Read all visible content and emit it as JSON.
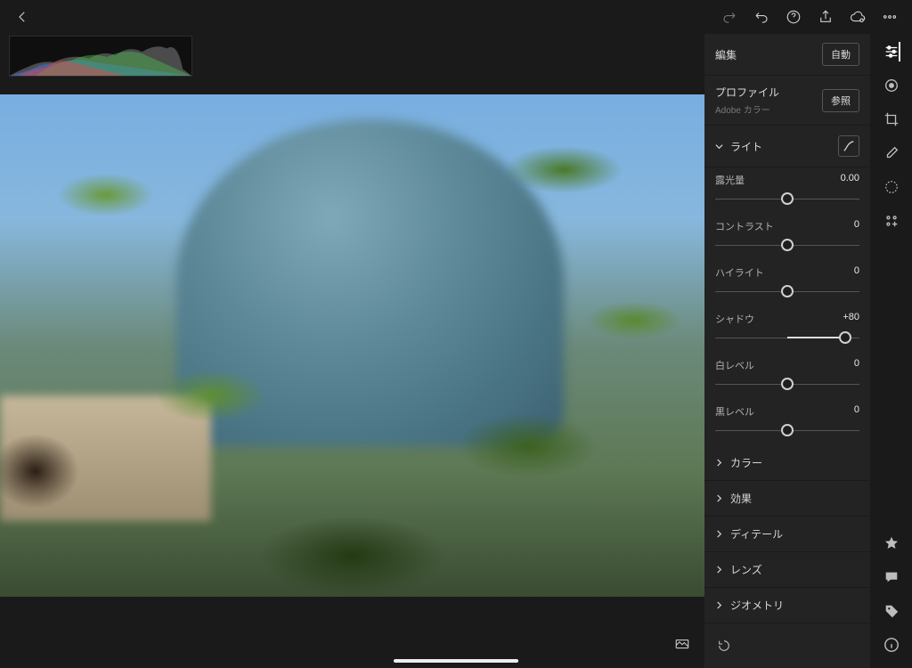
{
  "topbar": {
    "icons": {
      "back": "back-icon",
      "redo": "redo-icon",
      "undo": "undo-icon",
      "help": "help-icon",
      "share": "share-icon",
      "cloud": "cloud-icon",
      "more": "more-icon"
    }
  },
  "panel": {
    "edit_label": "編集",
    "auto_label": "自動",
    "profile_label": "プロファイル",
    "profile_name": "Adobe カラー",
    "browse_label": "参照",
    "reset_icon": "reset-icon"
  },
  "light": {
    "title": "ライト",
    "sliders": [
      {
        "label": "露光量",
        "value": "0.00",
        "pos": 50
      },
      {
        "label": "コントラスト",
        "value": "0",
        "pos": 50
      },
      {
        "label": "ハイライト",
        "value": "0",
        "pos": 50
      },
      {
        "label": "シャドウ",
        "value": "+80",
        "pos": 90
      },
      {
        "label": "白レベル",
        "value": "0",
        "pos": 50
      },
      {
        "label": "黒レベル",
        "value": "0",
        "pos": 50
      }
    ]
  },
  "sections": {
    "color": "カラー",
    "effects": "効果",
    "detail": "ディテール",
    "lens": "レンズ",
    "geometry": "ジオメトリ"
  },
  "tools": {
    "sliders": "adjust-icon",
    "color_mixer": "color-circle-icon",
    "crop": "crop-icon",
    "healing": "healing-brush-icon",
    "masking": "masking-icon",
    "presets": "presets-icon",
    "star": "star-icon",
    "comment": "comment-icon",
    "tag": "tag-icon",
    "info": "info-icon"
  }
}
